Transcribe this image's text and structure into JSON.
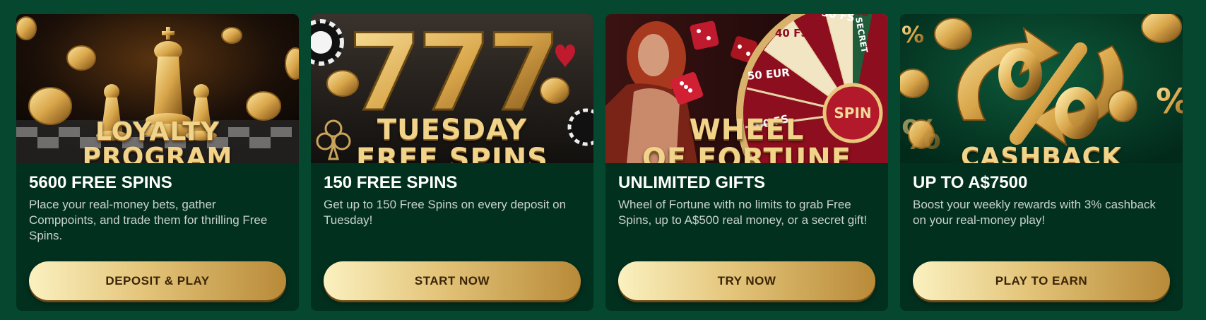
{
  "cards": [
    {
      "banner_title": "LOYALTY PROGRAM",
      "title": "5600 FREE SPINS",
      "description": "Place your real-money bets, gather Comppoints, and trade them for thrilling Free Spins.",
      "button": "DEPOSIT & PLAY"
    },
    {
      "banner_title_1": "TUESDAY",
      "banner_title_2": "FREE SPINS",
      "banner_sevens": "777",
      "title": "150 FREE SPINS",
      "description": "Get up to 150 Free Spins on every deposit on Tuesday!",
      "button": "START NOW"
    },
    {
      "banner_title_1": "WHEEL",
      "banner_title_2": "OF FORTUNE",
      "wheel_segments": [
        "100 FS",
        "50 EUR",
        "40 FS",
        "30 FS",
        "20 FS",
        "SECRET"
      ],
      "wheel_center": "SPIN",
      "title": "UNLIMITED GIFTS",
      "description": "Wheel of Fortune with no limits to grab Free Spins, up to A$500 real money, or a secret gift!",
      "button": "TRY NOW"
    },
    {
      "banner_title": "CASHBACK",
      "title": "UP TO A$7500",
      "description": "Boost your weekly rewards with 3% cashback on your real-money play!",
      "button": "PLAY TO EARN"
    }
  ],
  "colors": {
    "page_background": "#06472f",
    "card_background": "#02301f",
    "gold_light": "#fbf1c0",
    "gold_dark": "#b88a38",
    "button_text": "#3a2408"
  }
}
